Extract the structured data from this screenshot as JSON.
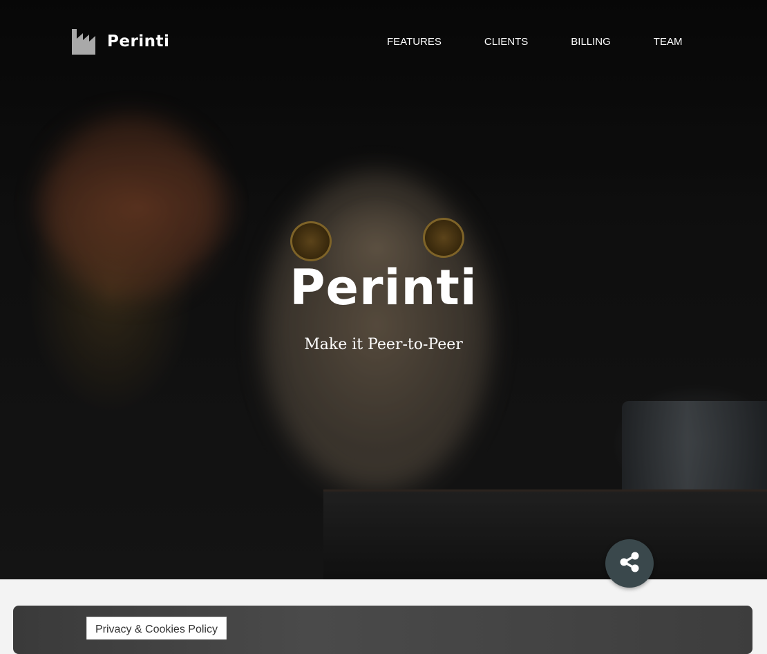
{
  "brand": {
    "name": "Perinti",
    "logo_icon": "factory-icon"
  },
  "nav": {
    "items": [
      {
        "label": "FEATURES"
      },
      {
        "label": "CLIENTS"
      },
      {
        "label": "BILLING"
      },
      {
        "label": "TEAM"
      }
    ]
  },
  "hero": {
    "title": "Perinti",
    "subtitle": "Make it Peer-to-Peer"
  },
  "share": {
    "icon": "share-icon",
    "color": "#3a484c"
  },
  "cookie_banner": {
    "label": "Privacy & Cookies Policy"
  }
}
